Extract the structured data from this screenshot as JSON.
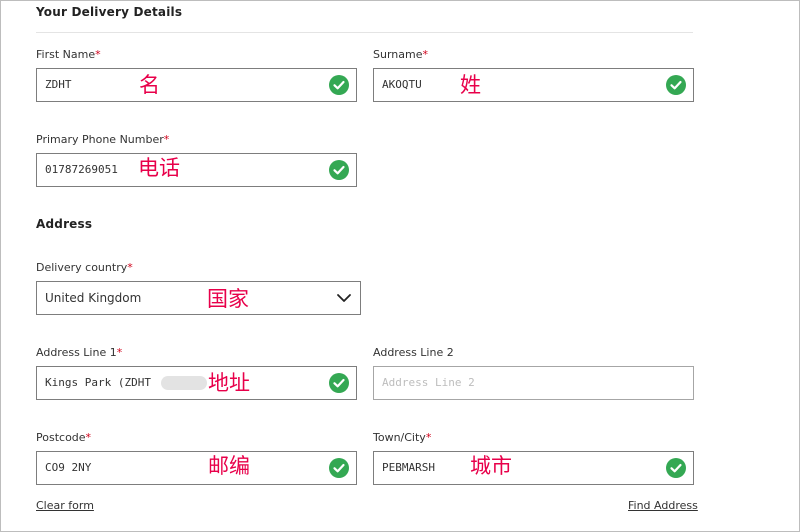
{
  "section": {
    "title": "Your Delivery Details"
  },
  "first_name": {
    "label": "First Name",
    "value": "ZDHT",
    "annotation": "名"
  },
  "surname": {
    "label": "Surname",
    "value": "AKOQTU",
    "annotation": "姓"
  },
  "phone": {
    "label": "Primary Phone Number",
    "value": "01787269051",
    "annotation": "电话"
  },
  "address": {
    "title": "Address"
  },
  "country": {
    "label": "Delivery country",
    "value": "United Kingdom",
    "annotation": "国家"
  },
  "address1": {
    "label": "Address Line 1",
    "value": "Kings Park (ZDHT",
    "annotation": "地址"
  },
  "address2": {
    "label": "Address Line 2",
    "placeholder": "Address Line 2"
  },
  "postcode": {
    "label": "Postcode",
    "value": "CO9 2NY",
    "annotation": "邮编"
  },
  "town": {
    "label": "Town/City",
    "value": "PEBMARSH",
    "annotation": "城市"
  },
  "required_marker": "*",
  "links": {
    "clear_form": "Clear form",
    "find_address": "Find Address"
  },
  "colors": {
    "check": "#34a853",
    "required": "#d0021b",
    "annotation": "#e8004a",
    "border": "#7d7d7d"
  },
  "icons": {
    "valid": "check-circle-icon",
    "dropdown": "chevron-down-icon"
  }
}
